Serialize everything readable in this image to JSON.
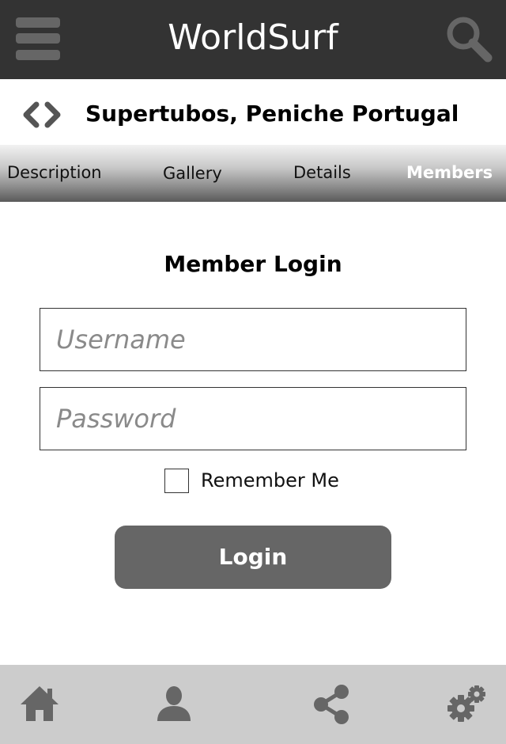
{
  "header": {
    "title": "WorldSurf",
    "menu_icon": "hamburger-menu-icon",
    "search_icon": "search-icon",
    "background_color": "#333333"
  },
  "location": {
    "title": "Supertubos, Peniche Portugal",
    "prev_icon": "chevron-left-icon",
    "next_icon": "chevron-right-icon"
  },
  "tabs": [
    {
      "label": "Description",
      "active": false
    },
    {
      "label": "Gallery",
      "active": false
    },
    {
      "label": "Details",
      "active": false
    },
    {
      "label": "Members",
      "active": true
    }
  ],
  "login": {
    "heading": "Member Login",
    "username_placeholder": "Username",
    "username_value": "",
    "password_placeholder": "Password",
    "password_value": "",
    "remember_label": "Remember Me",
    "remember_checked": false,
    "button_label": "Login",
    "button_color": "#666666"
  },
  "bottom_nav": {
    "items": [
      {
        "icon": "home-icon"
      },
      {
        "icon": "user-profile-icon"
      },
      {
        "icon": "share-icon"
      },
      {
        "icon": "settings-gears-icon"
      }
    ],
    "background_color": "#cccccc",
    "icon_color": "#666666"
  }
}
